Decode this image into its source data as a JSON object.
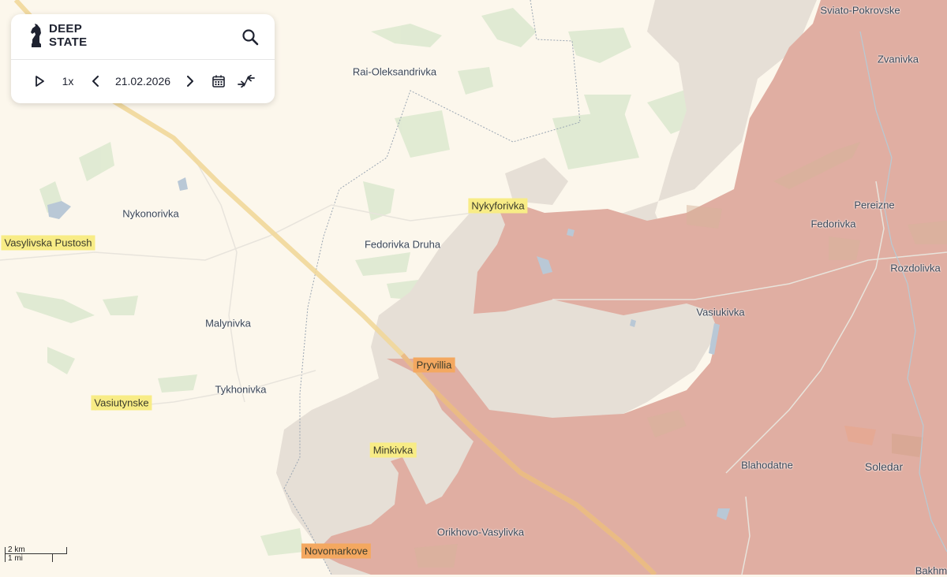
{
  "app": {
    "brand_line1": "DEEP",
    "brand_line2": "STATE"
  },
  "toolbar": {
    "speed": "1x",
    "date": "21.02.2026",
    "icons": [
      "play-icon",
      "chevron-left-icon",
      "chevron-right-icon",
      "calendar-icon",
      "compare-arrows-icon",
      "search-icon"
    ]
  },
  "scale": {
    "metric": "2 km",
    "imperial": "1 mi"
  },
  "colors": {
    "land": "#fcf7ec",
    "occupied": "#e0aea2",
    "gray_zone": "#e6dfd6",
    "forest": "#dfead2",
    "highway": "#f1d79a",
    "highlight_yellow": "#f8ec86",
    "highlight_orange": "#f4a860"
  },
  "places": {
    "sviato_pokrovske": "Sviato-Pokrovske",
    "zvanivka": "Zvanivka",
    "rai_oleksandrivka": "Rai-Oleksandrivka",
    "nykyforivka": "Nykyforivka",
    "pereizne": "Pereizne",
    "nykonorivka": "Nykonorivka",
    "fedorivka": "Fedorivka",
    "vasylivska_pustosh": "Vasylivska Pustosh",
    "fedorivka_druha": "Fedorivka Druha",
    "rozdolivka": "Rozdolivka",
    "vasiukivka": "Vasiukivka",
    "malynivka": "Malynivka",
    "pryvillia": "Pryvillia",
    "tykhonivka": "Tykhonivka",
    "vasiutynske": "Vasiutynske",
    "minkivka": "Minkivka",
    "blahodatne": "Blahodatne",
    "soledar": "Soledar",
    "orikhovo_vasylivka": "Orikhovo-Vasylivka",
    "novomarkove": "Novomarkove",
    "bakhm": "Bakhm"
  }
}
